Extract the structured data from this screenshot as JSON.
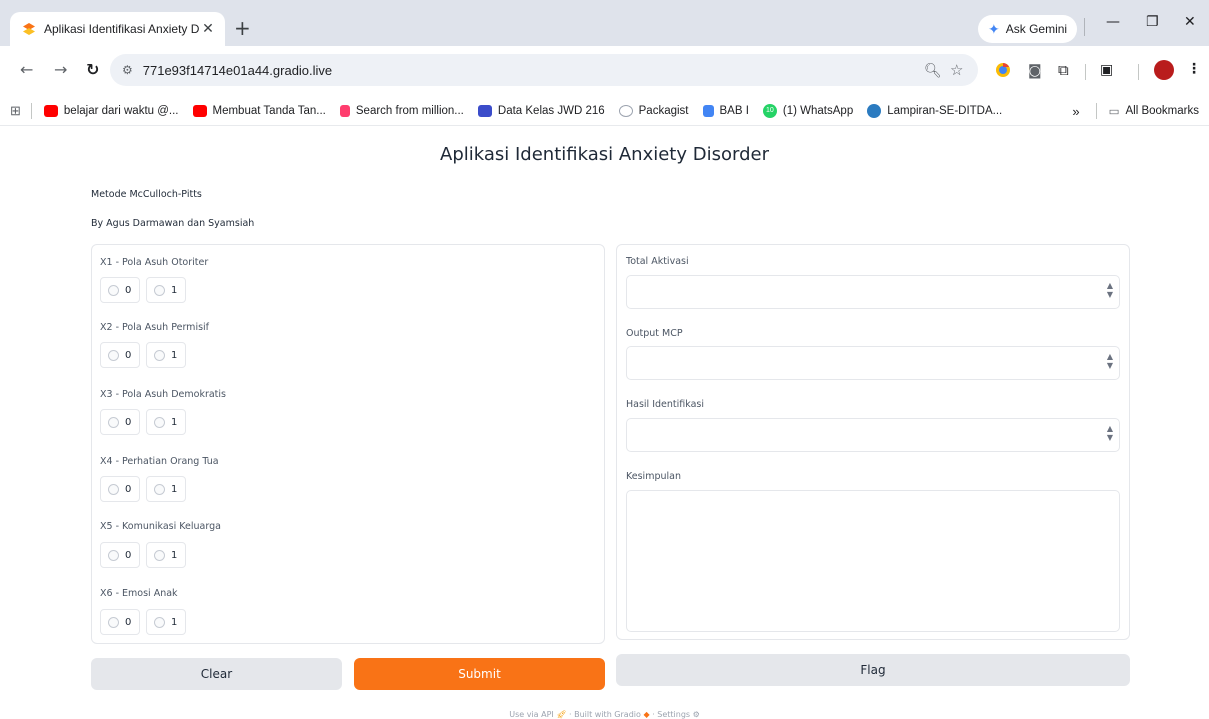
{
  "browser": {
    "tab_title": "Aplikasi Identifikasi Anxiety Dis",
    "new_tab": "+",
    "ask_gemini": "Ask Gemini",
    "url": "771e93f14714e01a44.gradio.live",
    "bookmarks": [
      "belajar dari waktu @...",
      "Membuat Tanda Tan...",
      "Search from million...",
      "Data Kelas JWD 216",
      "Packagist",
      "BAB I",
      "(1) WhatsApp",
      "Lampiran-SE-DITDA..."
    ],
    "whatsapp_badge": "10",
    "more_bookmarks": "»",
    "all_bookmarks": "All Bookmarks"
  },
  "app": {
    "title": "Aplikasi Identifikasi Anxiety Disorder",
    "method": "Metode McCulloch-Pitts",
    "authors": "By Agus Darmawan dan Syamsiah"
  },
  "inputs": [
    {
      "label": "X1 - Pola Asuh Otoriter",
      "options": [
        "0",
        "1"
      ]
    },
    {
      "label": "X2 - Pola Asuh Permisif",
      "options": [
        "0",
        "1"
      ]
    },
    {
      "label": "X3 - Pola Asuh Demokratis",
      "options": [
        "0",
        "1"
      ]
    },
    {
      "label": "X4 - Perhatian Orang Tua",
      "options": [
        "0",
        "1"
      ]
    },
    {
      "label": "X5 - Komunikasi Keluarga",
      "options": [
        "0",
        "1"
      ]
    },
    {
      "label": "X6 - Emosi Anak",
      "options": [
        "0",
        "1"
      ]
    }
  ],
  "outputs": {
    "total_aktivasi": {
      "label": "Total Aktivasi",
      "value": ""
    },
    "output_mcp": {
      "label": "Output MCP",
      "value": ""
    },
    "hasil_identifikasi": {
      "label": "Hasil Identifikasi",
      "value": ""
    },
    "kesimpulan": {
      "label": "Kesimpulan",
      "value": ""
    }
  },
  "buttons": {
    "clear": "Clear",
    "submit": "Submit",
    "flag": "Flag"
  },
  "footer": {
    "api": "Use via API",
    "built": "Built with Gradio",
    "settings": "Settings",
    "sep": "·"
  },
  "colors": {
    "accent": "#f97316",
    "secondary_button": "#e5e7eb"
  }
}
